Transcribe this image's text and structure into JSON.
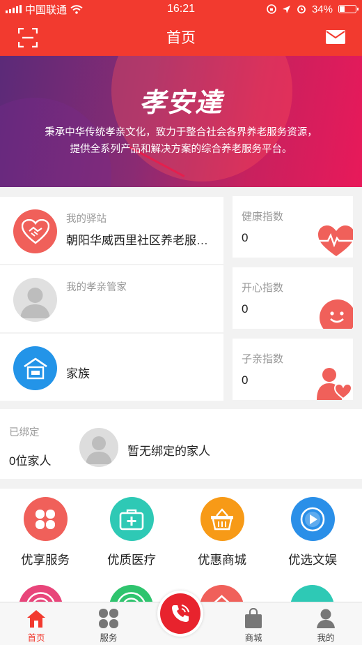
{
  "status_bar": {
    "carrier": "中国联通",
    "time": "16:21",
    "battery": "34%",
    "battery_level": 0.34
  },
  "navbar": {
    "title": "首页",
    "left_icon": "scan-icon",
    "right_icon": "mail-icon"
  },
  "banner": {
    "logo": "孝安達",
    "line1": "秉承中华传统孝亲文化，致力于整合社会各界养老服务资源，",
    "line2": "提供全系列产品和解决方案的综合养老服务平台。"
  },
  "station": {
    "label": "我的驿站",
    "name": "朝阳华威西里社区养老服务驿站"
  },
  "butler": {
    "label": "我的孝亲管家",
    "name": ""
  },
  "family": {
    "name": "家族"
  },
  "indices": [
    {
      "label": "健康指数",
      "value": "0",
      "icon": "heart-pulse-icon"
    },
    {
      "label": "开心指数",
      "value": "0",
      "icon": "smile-icon"
    },
    {
      "label": "子亲指数",
      "value": "0",
      "icon": "parent-child-icon"
    }
  ],
  "binding": {
    "label": "已绑定",
    "count": "0位家人",
    "empty_text": "暂无绑定的家人"
  },
  "services": [
    {
      "name": "优享服务",
      "color": "#f0605a",
      "icon": "clover-icon"
    },
    {
      "name": "优质医疗",
      "color": "#2ec9b5",
      "icon": "medical-kit-icon"
    },
    {
      "name": "优惠商城",
      "color": "#f79a17",
      "icon": "shopping-basket-icon"
    },
    {
      "name": "优选文娱",
      "color": "#2a8fe8",
      "icon": "play-icon"
    }
  ],
  "tabs": [
    {
      "label": "首页",
      "icon": "home-icon",
      "active": true
    },
    {
      "label": "服务",
      "icon": "grid-icon",
      "active": false
    },
    {
      "label": "商城",
      "icon": "bag-icon",
      "active": false
    },
    {
      "label": "我的",
      "icon": "person-icon",
      "active": false
    }
  ],
  "colors": {
    "primary": "#f23a2f",
    "page_bg": "#f2f2f2"
  }
}
